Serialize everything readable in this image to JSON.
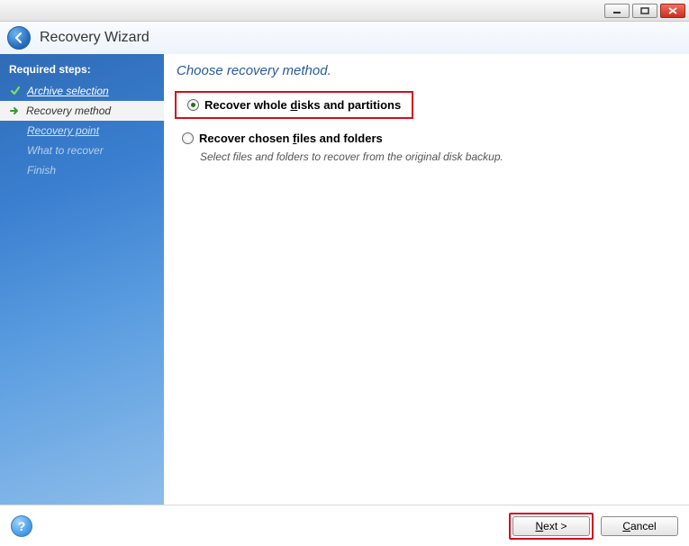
{
  "window": {
    "title": "Recovery Wizard"
  },
  "sidebar": {
    "header": "Required steps:",
    "steps": [
      {
        "label": "Archive selection",
        "state": "done"
      },
      {
        "label": "Recovery method",
        "state": "current"
      },
      {
        "label": "Recovery point",
        "state": "future"
      },
      {
        "label": "What to recover",
        "state": "inactive"
      },
      {
        "label": "Finish",
        "state": "inactive"
      }
    ]
  },
  "main": {
    "heading": "Choose recovery method.",
    "options": [
      {
        "label_pre": "Recover whole ",
        "label_ul": "d",
        "label_post": "isks and partitions",
        "selected": true,
        "highlighted": true
      },
      {
        "label_pre": "Recover chosen ",
        "label_ul": "f",
        "label_post": "iles and folders",
        "selected": false,
        "description": "Select files and folders to recover from the original disk backup."
      }
    ]
  },
  "footer": {
    "next_pre": "",
    "next_ul": "N",
    "next_post": "ext >",
    "cancel_pre": "",
    "cancel_ul": "C",
    "cancel_post": "ancel"
  }
}
